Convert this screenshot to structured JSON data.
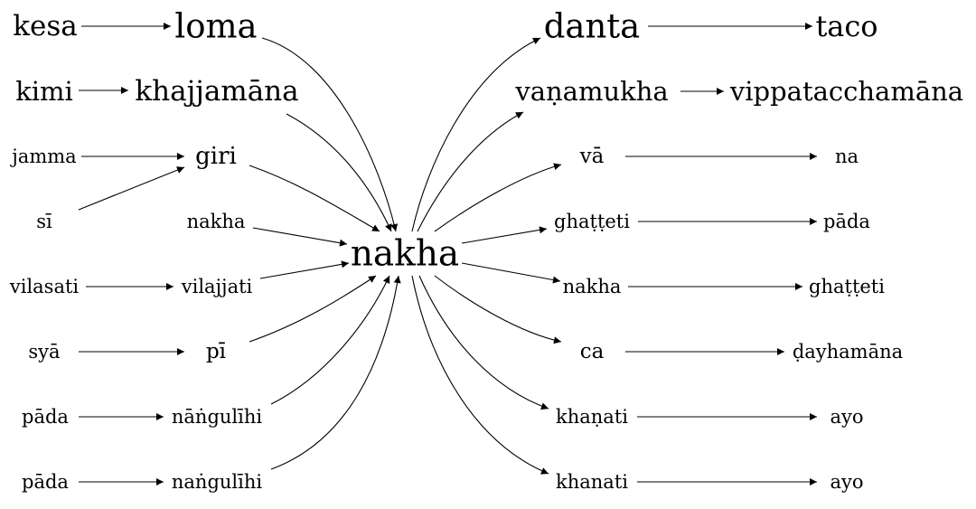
{
  "center": "nakha",
  "nodes": {
    "kesa": "kesa",
    "loma": "loma",
    "kimi": "kimi",
    "khajjamana": "khajjamāna",
    "jamma": "jamma",
    "si": "sī",
    "giri": "giri",
    "nakha_in": "nakha",
    "vilasati": "vilasati",
    "vilajjati": "vilajjati",
    "sya": "syā",
    "pi": "pī",
    "pada1": "pāda",
    "nangulihi1": "nāṅgulīhi",
    "pada2": "pāda",
    "nangulihi2": "naṅgulīhi",
    "danta": "danta",
    "taco": "taco",
    "vanamukha": "vaṇamukha",
    "vippatacchamana": "vippatacchamāna",
    "va": "vā",
    "na": "na",
    "ghatteti": "ghaṭṭeti",
    "pada_out": "pāda",
    "nakha_out": "nakha",
    "ghatteti_out": "ghaṭṭeti",
    "ca": "ca",
    "dayhamana": "ḍayhamāna",
    "khanati1": "khaṇati",
    "ayo1": "ayo",
    "khanati2": "khanati",
    "ayo2": "ayo"
  },
  "edges": [
    [
      "kesa",
      "loma"
    ],
    [
      "loma",
      "nakha"
    ],
    [
      "kimi",
      "khajjamana"
    ],
    [
      "khajjamana",
      "nakha"
    ],
    [
      "jamma",
      "giri"
    ],
    [
      "si",
      "giri"
    ],
    [
      "giri",
      "nakha"
    ],
    [
      "nakha_in",
      "nakha"
    ],
    [
      "vilasati",
      "vilajjati"
    ],
    [
      "vilajjati",
      "nakha"
    ],
    [
      "sya",
      "pi"
    ],
    [
      "pi",
      "nakha"
    ],
    [
      "pada1",
      "nangulihi1"
    ],
    [
      "nangulihi1",
      "nakha"
    ],
    [
      "pada2",
      "nangulihi2"
    ],
    [
      "nangulihi2",
      "nakha"
    ],
    [
      "nakha",
      "danta"
    ],
    [
      "danta",
      "taco"
    ],
    [
      "nakha",
      "vanamukha"
    ],
    [
      "vanamukha",
      "vippatacchamana"
    ],
    [
      "nakha",
      "va"
    ],
    [
      "va",
      "na"
    ],
    [
      "nakha",
      "ghatteti"
    ],
    [
      "ghatteti",
      "pada_out"
    ],
    [
      "nakha",
      "nakha_out"
    ],
    [
      "nakha_out",
      "ghatteti_out"
    ],
    [
      "nakha",
      "ca"
    ],
    [
      "ca",
      "dayhamana"
    ],
    [
      "nakha",
      "khanati1"
    ],
    [
      "khanati1",
      "ayo1"
    ],
    [
      "nakha",
      "khanati2"
    ],
    [
      "khanati2",
      "ayo2"
    ]
  ]
}
